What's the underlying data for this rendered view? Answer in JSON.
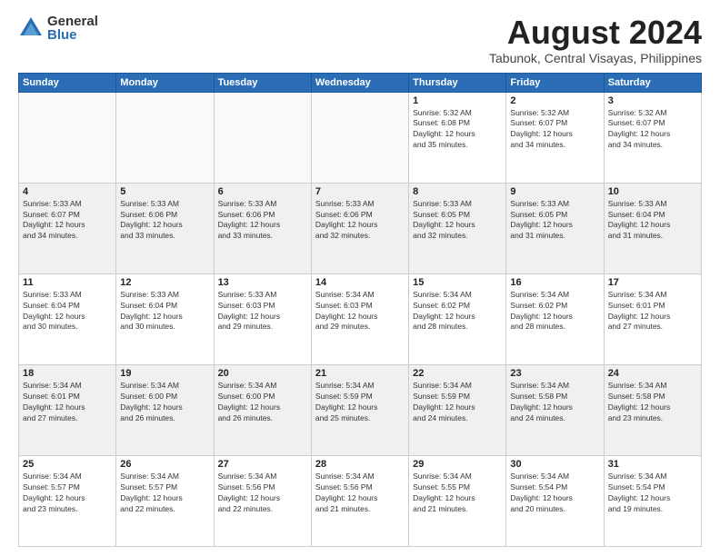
{
  "logo": {
    "general": "General",
    "blue": "Blue"
  },
  "title": "August 2024",
  "subtitle": "Tabunok, Central Visayas, Philippines",
  "days_of_week": [
    "Sunday",
    "Monday",
    "Tuesday",
    "Wednesday",
    "Thursday",
    "Friday",
    "Saturday"
  ],
  "weeks": [
    [
      {
        "day": "",
        "info": ""
      },
      {
        "day": "",
        "info": ""
      },
      {
        "day": "",
        "info": ""
      },
      {
        "day": "",
        "info": ""
      },
      {
        "day": "1",
        "info": "Sunrise: 5:32 AM\nSunset: 6:08 PM\nDaylight: 12 hours\nand 35 minutes."
      },
      {
        "day": "2",
        "info": "Sunrise: 5:32 AM\nSunset: 6:07 PM\nDaylight: 12 hours\nand 34 minutes."
      },
      {
        "day": "3",
        "info": "Sunrise: 5:32 AM\nSunset: 6:07 PM\nDaylight: 12 hours\nand 34 minutes."
      }
    ],
    [
      {
        "day": "4",
        "info": "Sunrise: 5:33 AM\nSunset: 6:07 PM\nDaylight: 12 hours\nand 34 minutes."
      },
      {
        "day": "5",
        "info": "Sunrise: 5:33 AM\nSunset: 6:06 PM\nDaylight: 12 hours\nand 33 minutes."
      },
      {
        "day": "6",
        "info": "Sunrise: 5:33 AM\nSunset: 6:06 PM\nDaylight: 12 hours\nand 33 minutes."
      },
      {
        "day": "7",
        "info": "Sunrise: 5:33 AM\nSunset: 6:06 PM\nDaylight: 12 hours\nand 32 minutes."
      },
      {
        "day": "8",
        "info": "Sunrise: 5:33 AM\nSunset: 6:05 PM\nDaylight: 12 hours\nand 32 minutes."
      },
      {
        "day": "9",
        "info": "Sunrise: 5:33 AM\nSunset: 6:05 PM\nDaylight: 12 hours\nand 31 minutes."
      },
      {
        "day": "10",
        "info": "Sunrise: 5:33 AM\nSunset: 6:04 PM\nDaylight: 12 hours\nand 31 minutes."
      }
    ],
    [
      {
        "day": "11",
        "info": "Sunrise: 5:33 AM\nSunset: 6:04 PM\nDaylight: 12 hours\nand 30 minutes."
      },
      {
        "day": "12",
        "info": "Sunrise: 5:33 AM\nSunset: 6:04 PM\nDaylight: 12 hours\nand 30 minutes."
      },
      {
        "day": "13",
        "info": "Sunrise: 5:33 AM\nSunset: 6:03 PM\nDaylight: 12 hours\nand 29 minutes."
      },
      {
        "day": "14",
        "info": "Sunrise: 5:34 AM\nSunset: 6:03 PM\nDaylight: 12 hours\nand 29 minutes."
      },
      {
        "day": "15",
        "info": "Sunrise: 5:34 AM\nSunset: 6:02 PM\nDaylight: 12 hours\nand 28 minutes."
      },
      {
        "day": "16",
        "info": "Sunrise: 5:34 AM\nSunset: 6:02 PM\nDaylight: 12 hours\nand 28 minutes."
      },
      {
        "day": "17",
        "info": "Sunrise: 5:34 AM\nSunset: 6:01 PM\nDaylight: 12 hours\nand 27 minutes."
      }
    ],
    [
      {
        "day": "18",
        "info": "Sunrise: 5:34 AM\nSunset: 6:01 PM\nDaylight: 12 hours\nand 27 minutes."
      },
      {
        "day": "19",
        "info": "Sunrise: 5:34 AM\nSunset: 6:00 PM\nDaylight: 12 hours\nand 26 minutes."
      },
      {
        "day": "20",
        "info": "Sunrise: 5:34 AM\nSunset: 6:00 PM\nDaylight: 12 hours\nand 26 minutes."
      },
      {
        "day": "21",
        "info": "Sunrise: 5:34 AM\nSunset: 5:59 PM\nDaylight: 12 hours\nand 25 minutes."
      },
      {
        "day": "22",
        "info": "Sunrise: 5:34 AM\nSunset: 5:59 PM\nDaylight: 12 hours\nand 24 minutes."
      },
      {
        "day": "23",
        "info": "Sunrise: 5:34 AM\nSunset: 5:58 PM\nDaylight: 12 hours\nand 24 minutes."
      },
      {
        "day": "24",
        "info": "Sunrise: 5:34 AM\nSunset: 5:58 PM\nDaylight: 12 hours\nand 23 minutes."
      }
    ],
    [
      {
        "day": "25",
        "info": "Sunrise: 5:34 AM\nSunset: 5:57 PM\nDaylight: 12 hours\nand 23 minutes."
      },
      {
        "day": "26",
        "info": "Sunrise: 5:34 AM\nSunset: 5:57 PM\nDaylight: 12 hours\nand 22 minutes."
      },
      {
        "day": "27",
        "info": "Sunrise: 5:34 AM\nSunset: 5:56 PM\nDaylight: 12 hours\nand 22 minutes."
      },
      {
        "day": "28",
        "info": "Sunrise: 5:34 AM\nSunset: 5:56 PM\nDaylight: 12 hours\nand 21 minutes."
      },
      {
        "day": "29",
        "info": "Sunrise: 5:34 AM\nSunset: 5:55 PM\nDaylight: 12 hours\nand 21 minutes."
      },
      {
        "day": "30",
        "info": "Sunrise: 5:34 AM\nSunset: 5:54 PM\nDaylight: 12 hours\nand 20 minutes."
      },
      {
        "day": "31",
        "info": "Sunrise: 5:34 AM\nSunset: 5:54 PM\nDaylight: 12 hours\nand 19 minutes."
      }
    ]
  ]
}
